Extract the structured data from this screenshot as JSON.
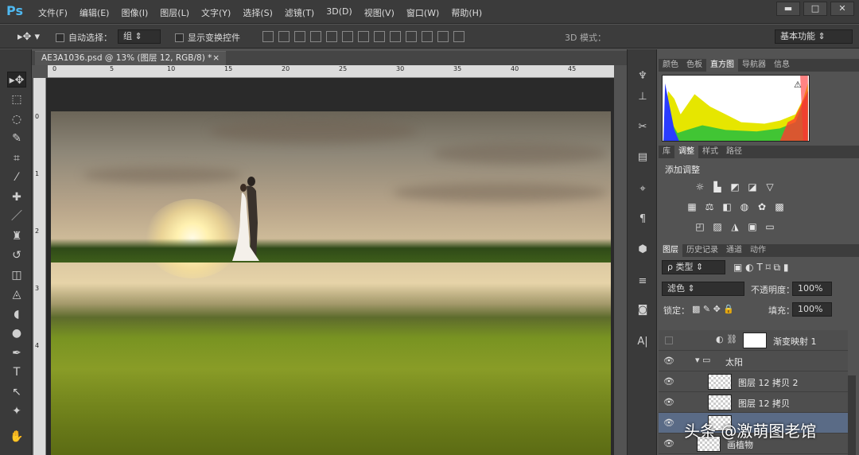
{
  "app": {
    "logo": "Ps"
  },
  "menu": [
    "文件(F)",
    "编辑(E)",
    "图像(I)",
    "图层(L)",
    "文字(Y)",
    "选择(S)",
    "滤镜(T)",
    "3D(D)",
    "视图(V)",
    "窗口(W)",
    "帮助(H)"
  ],
  "window_buttons": {
    "minimize": "▬",
    "maximize": "□",
    "close": "✕"
  },
  "options": {
    "auto_select_label": "自动选择：",
    "auto_select_value": "组",
    "show_transform_label": "显示变换控件",
    "mode_3d_label": "3D 模式：",
    "workspace": "基本功能"
  },
  "document": {
    "tab_title": "AE3A1036.psd @ 13% (图层 12, RGB/8) *",
    "close": "×",
    "ruler_h": [
      "0",
      "5",
      "10",
      "15",
      "20",
      "25",
      "30",
      "35",
      "40",
      "45"
    ],
    "ruler_v": [
      "0",
      "1",
      "2",
      "3",
      "4"
    ]
  },
  "panels": {
    "top_tabs": [
      "颜色",
      "色板",
      "直方图",
      "导航器",
      "信息"
    ],
    "adjust_tabs": [
      "库",
      "调整",
      "样式",
      "路径"
    ],
    "adjust_title": "添加调整",
    "layers_tabs": [
      "图层",
      "历史记录",
      "通道",
      "动作"
    ],
    "filter_label": "ρ 类型",
    "blend_mode": "滤色",
    "opacity_label": "不透明度：",
    "opacity_value": "100%",
    "lock_label": "锁定：",
    "fill_label": "填充：",
    "fill_value": "100%"
  },
  "layers": [
    {
      "name": "渐变映射 1",
      "type": "adjustment"
    },
    {
      "name": "太阳",
      "type": "group"
    },
    {
      "name": "图层 12 拷贝 2",
      "type": "layer"
    },
    {
      "name": "图层 12 拷贝",
      "type": "layer"
    },
    {
      "name": "画植物",
      "type": "layer"
    }
  ],
  "watermark": "头条 @激萌图老馆"
}
